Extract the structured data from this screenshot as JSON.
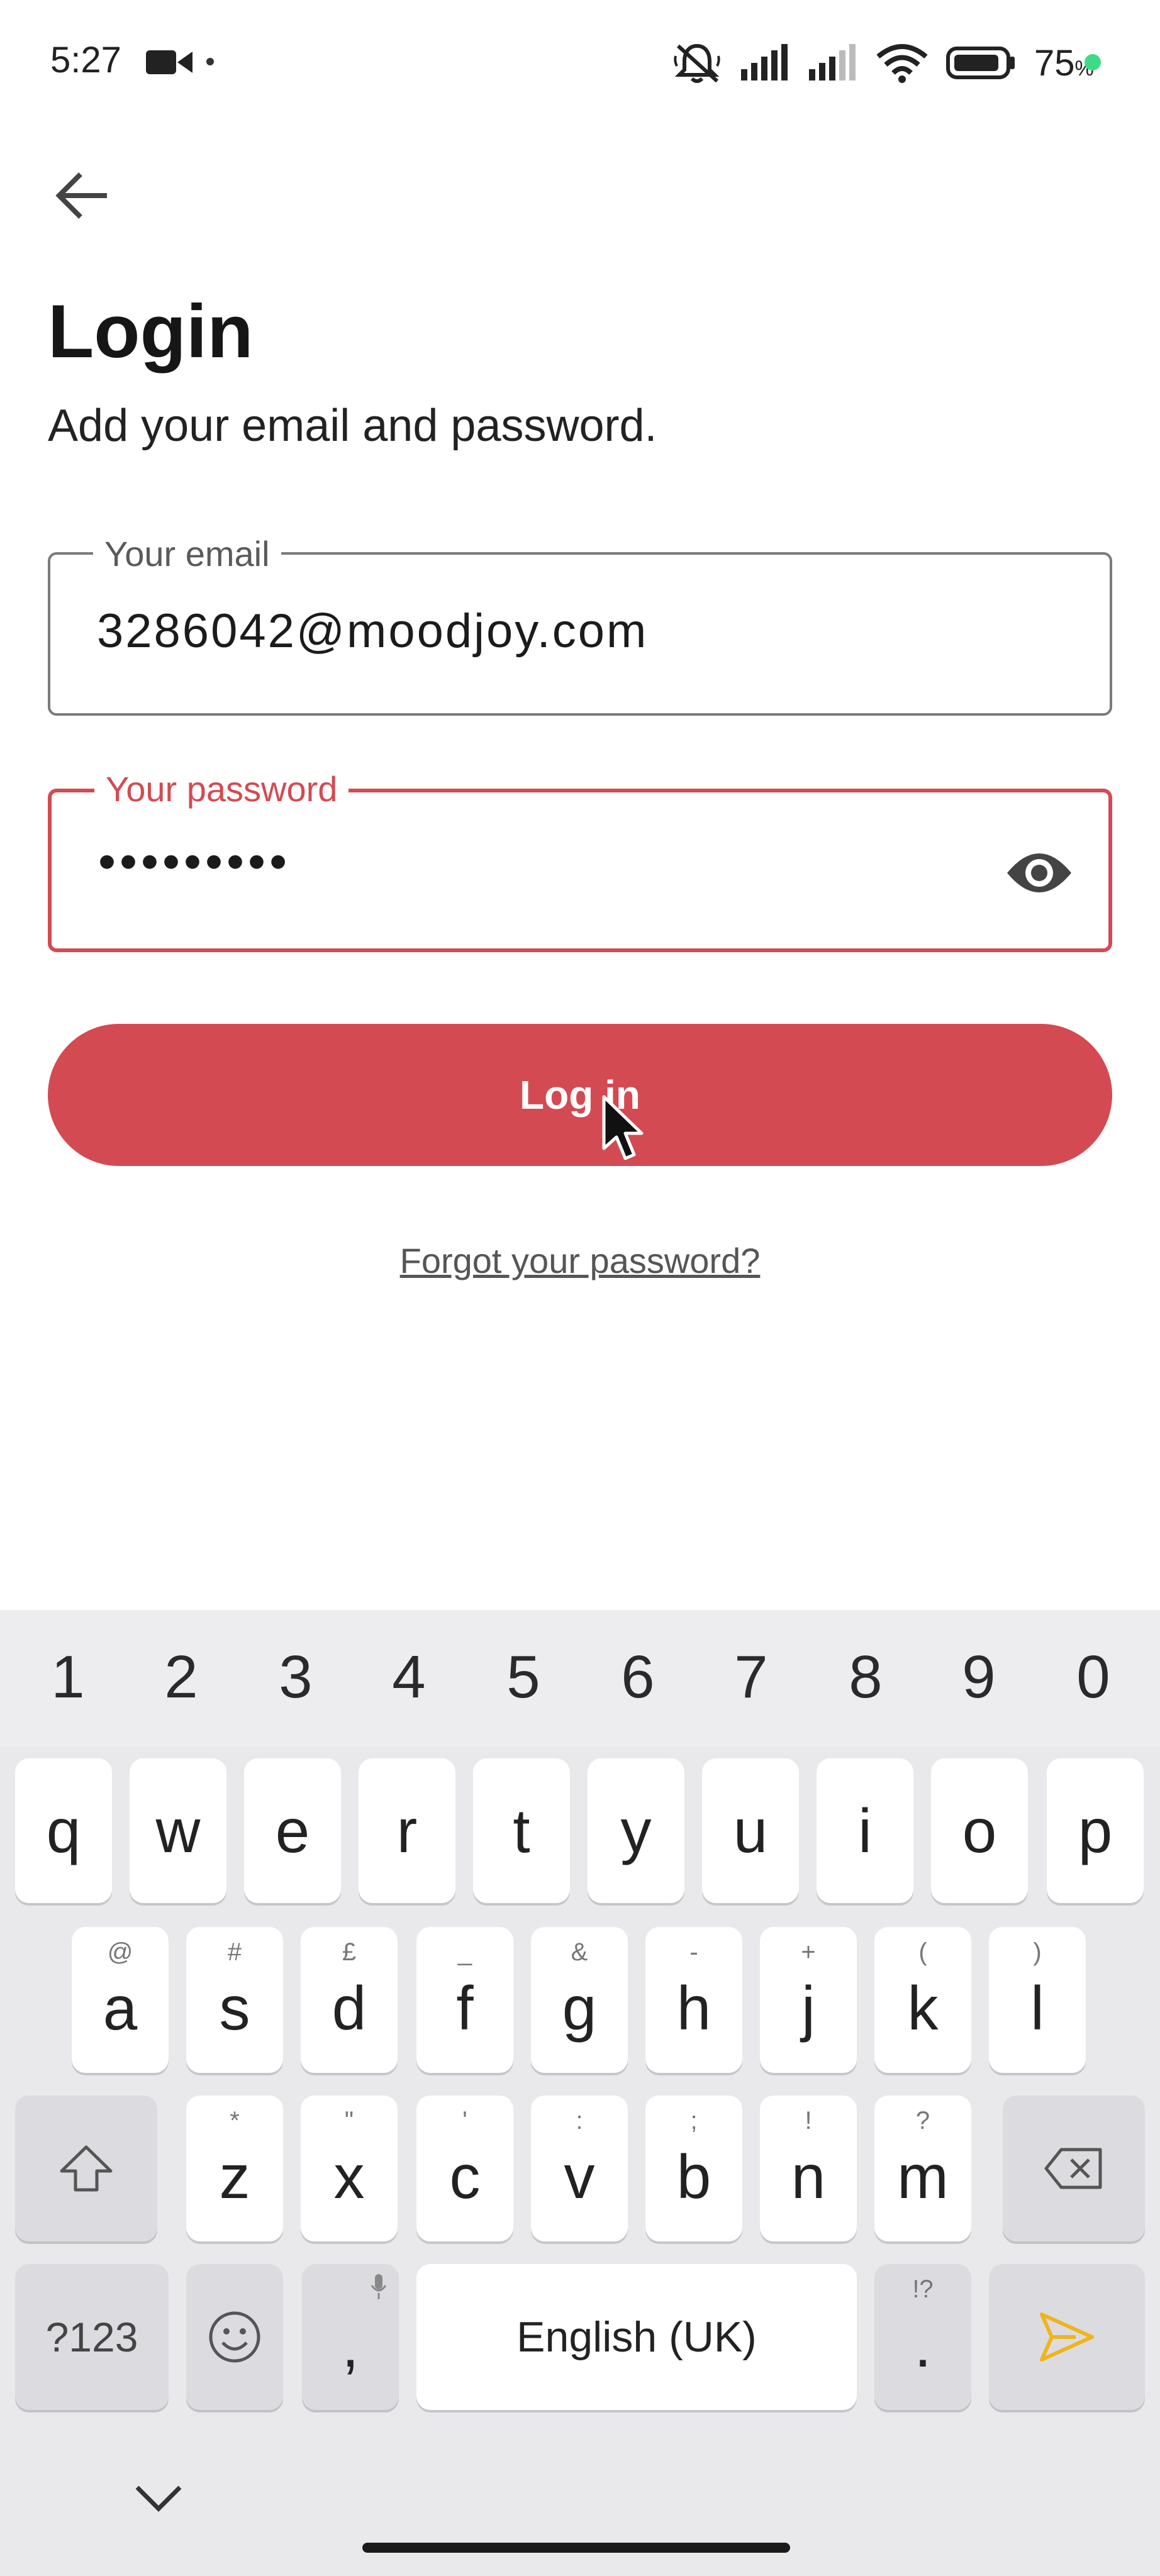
{
  "status_bar": {
    "time": "5:27",
    "battery_percent": "75",
    "battery_unit": "%",
    "icons": [
      "video-camera-icon",
      "mute-icon",
      "signal-icon",
      "signal-icon",
      "wifi-icon",
      "battery-icon"
    ]
  },
  "header": {
    "title": "Login",
    "subtitle": "Add your email and password."
  },
  "form": {
    "email_label": "Your email",
    "email_value": "3286042@moodjoy.com",
    "password_label": "Your password",
    "password_value": "•••••••••",
    "login_label": "Log in",
    "forgot_label": "Forgot your password?"
  },
  "colors": {
    "accent": "#d44a52",
    "keyboard_bg": "#e9e9ec",
    "send_icon": "#f0b41c"
  },
  "keyboard": {
    "numbers": [
      "1",
      "2",
      "3",
      "4",
      "5",
      "6",
      "7",
      "8",
      "9",
      "0"
    ],
    "row1": [
      "q",
      "w",
      "e",
      "r",
      "t",
      "y",
      "u",
      "i",
      "o",
      "p"
    ],
    "row2": [
      {
        "key": "a",
        "hint": "@"
      },
      {
        "key": "s",
        "hint": "#"
      },
      {
        "key": "d",
        "hint": "£"
      },
      {
        "key": "f",
        "hint": "_"
      },
      {
        "key": "g",
        "hint": "&"
      },
      {
        "key": "h",
        "hint": "-"
      },
      {
        "key": "j",
        "hint": "+"
      },
      {
        "key": "k",
        "hint": "("
      },
      {
        "key": "l",
        "hint": ")"
      }
    ],
    "row3": [
      {
        "key": "z",
        "hint": "*"
      },
      {
        "key": "x",
        "hint": "\""
      },
      {
        "key": "c",
        "hint": "'"
      },
      {
        "key": "v",
        "hint": ":"
      },
      {
        "key": "b",
        "hint": ";"
      },
      {
        "key": "n",
        "hint": "!"
      },
      {
        "key": "m",
        "hint": "?"
      }
    ],
    "symbols_label": "?123",
    "comma": ",",
    "space_label": "English (UK)",
    "period": ".",
    "period_hint": "!?"
  }
}
